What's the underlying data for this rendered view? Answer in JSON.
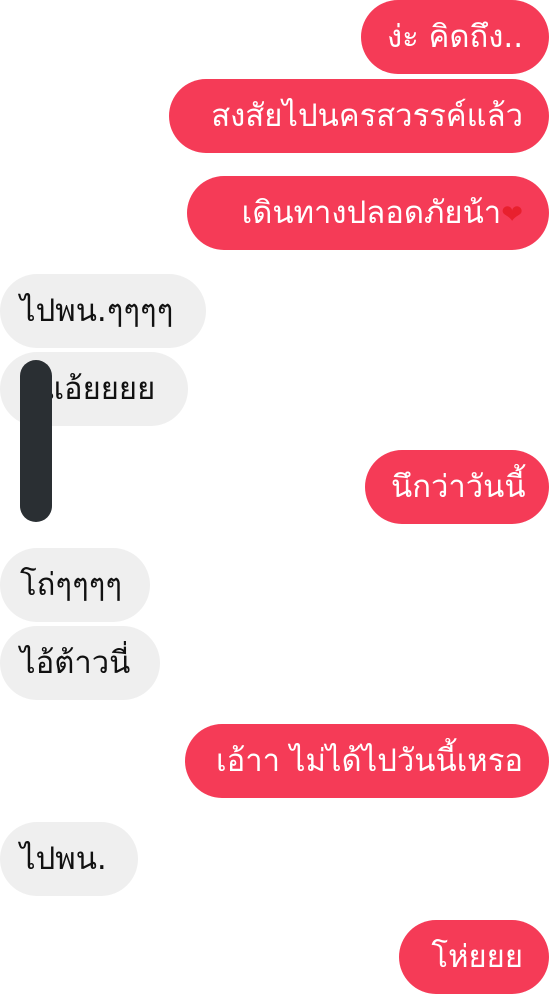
{
  "thread": {
    "outgoing_color": "#f53b57",
    "incoming_color": "#efefef",
    "messages": [
      {
        "side": "out",
        "text": "ง่ะ คิดถึง.."
      },
      {
        "side": "out",
        "text": "สงสัยไปนครสวรรค์แล้ว"
      },
      {
        "side": "out",
        "text": "เดินทางปลอดภัยน้า",
        "emoji": "❤"
      },
      {
        "side": "in",
        "text": "ไปพน.ๆๆๆๆ"
      },
      {
        "side": "in",
        "text": "แอ้ยยยย"
      },
      {
        "side": "out",
        "text": "นึกว่าวันนี้"
      },
      {
        "side": "in",
        "text": "โถ่ๆๆๆๆ"
      },
      {
        "side": "in",
        "text": "ไอ้ต้าวนี่"
      },
      {
        "side": "out",
        "text": "เอ้าา ไม่ได้ไปวันนี้เหรอ"
      },
      {
        "side": "in",
        "text": "ไปพน."
      },
      {
        "side": "out",
        "text": "โห่ยยย"
      }
    ]
  }
}
